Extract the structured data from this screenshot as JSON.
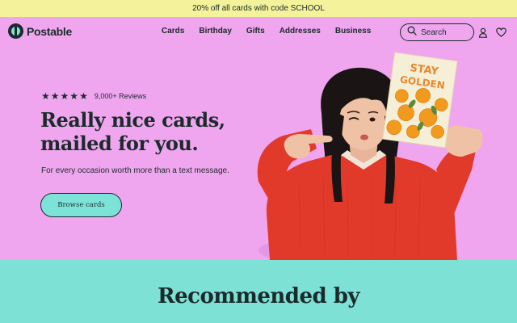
{
  "promo": {
    "text": "20% off all cards with code SCHOOL"
  },
  "header": {
    "logo_text": "Postable",
    "nav": [
      "Cards",
      "Birthday",
      "Gifts",
      "Addresses",
      "Business"
    ],
    "search_placeholder": "Search"
  },
  "hero": {
    "rating_stars": 5,
    "reviews_text": "9,000+ Reviews",
    "headline_line1": "Really nice cards,",
    "headline_line2": "mailed for you.",
    "subtext": "For every occasion worth more than a text message.",
    "cta_label": "Browse cards",
    "card_text_line1": "STAY",
    "card_text_line2": "GOLDEN"
  },
  "recommended": {
    "title": "Recommended by"
  },
  "colors": {
    "background": "#efa6ef",
    "promo": "#f4f29a",
    "accent_teal": "#7de3d8",
    "text": "#1b2b2b",
    "sweater_red": "#e23a2a",
    "marigold": "#f29a1e"
  },
  "icons": [
    "logo-mark",
    "search-icon",
    "user-icon",
    "heart-icon",
    "star-icon"
  ]
}
